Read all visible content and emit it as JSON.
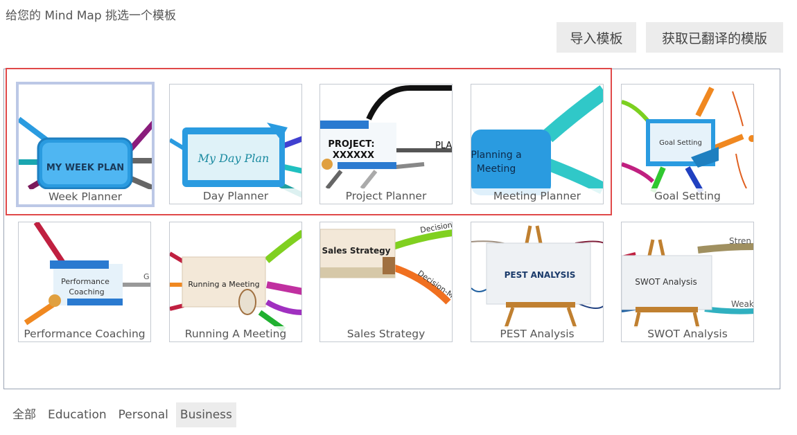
{
  "header": {
    "title": "给您的 Mind Map 挑选一个模板",
    "import_button": "导入模板",
    "translated_button": "获取已翻译的模版"
  },
  "templates": [
    {
      "label": "Week Planner",
      "card_text": "MY WEEK PLAN"
    },
    {
      "label": "Day Planner",
      "card_text": "My Day Plan"
    },
    {
      "label": "Project Planner",
      "card_text_1": "PROJECT:",
      "card_text_2": "XXXXXX",
      "side_text": "PLA"
    },
    {
      "label": "Meeting Planner",
      "card_text_1": "Planning a",
      "card_text_2": "Meeting"
    },
    {
      "label": "Goal Setting",
      "card_text": "Goal Setting"
    },
    {
      "label": "Performance Coaching",
      "card_text_1": "Performance",
      "card_text_2": "Coaching",
      "side_text": "G"
    },
    {
      "label": "Running A Meeting",
      "card_text": "Running a Meeting"
    },
    {
      "label": "Sales Strategy",
      "card_text": "Sales Strategy",
      "side_text_1": "Decision",
      "side_text_2": "Decision-Ma"
    },
    {
      "label": "PEST Analysis",
      "card_text": "PEST ANALYSIS"
    },
    {
      "label": "SWOT Analysis",
      "card_text": "SWOT Analysis",
      "side_text_1": "Stren",
      "side_text_2": "Weak"
    }
  ],
  "filters": [
    "全部",
    "Education",
    "Personal",
    "Business"
  ],
  "active_filter": "Business",
  "colors": {
    "highlight": "#e04848",
    "selected_border": "#bcc8e6",
    "button_bg": "#ececec",
    "card_blue": "#2a9be0"
  }
}
